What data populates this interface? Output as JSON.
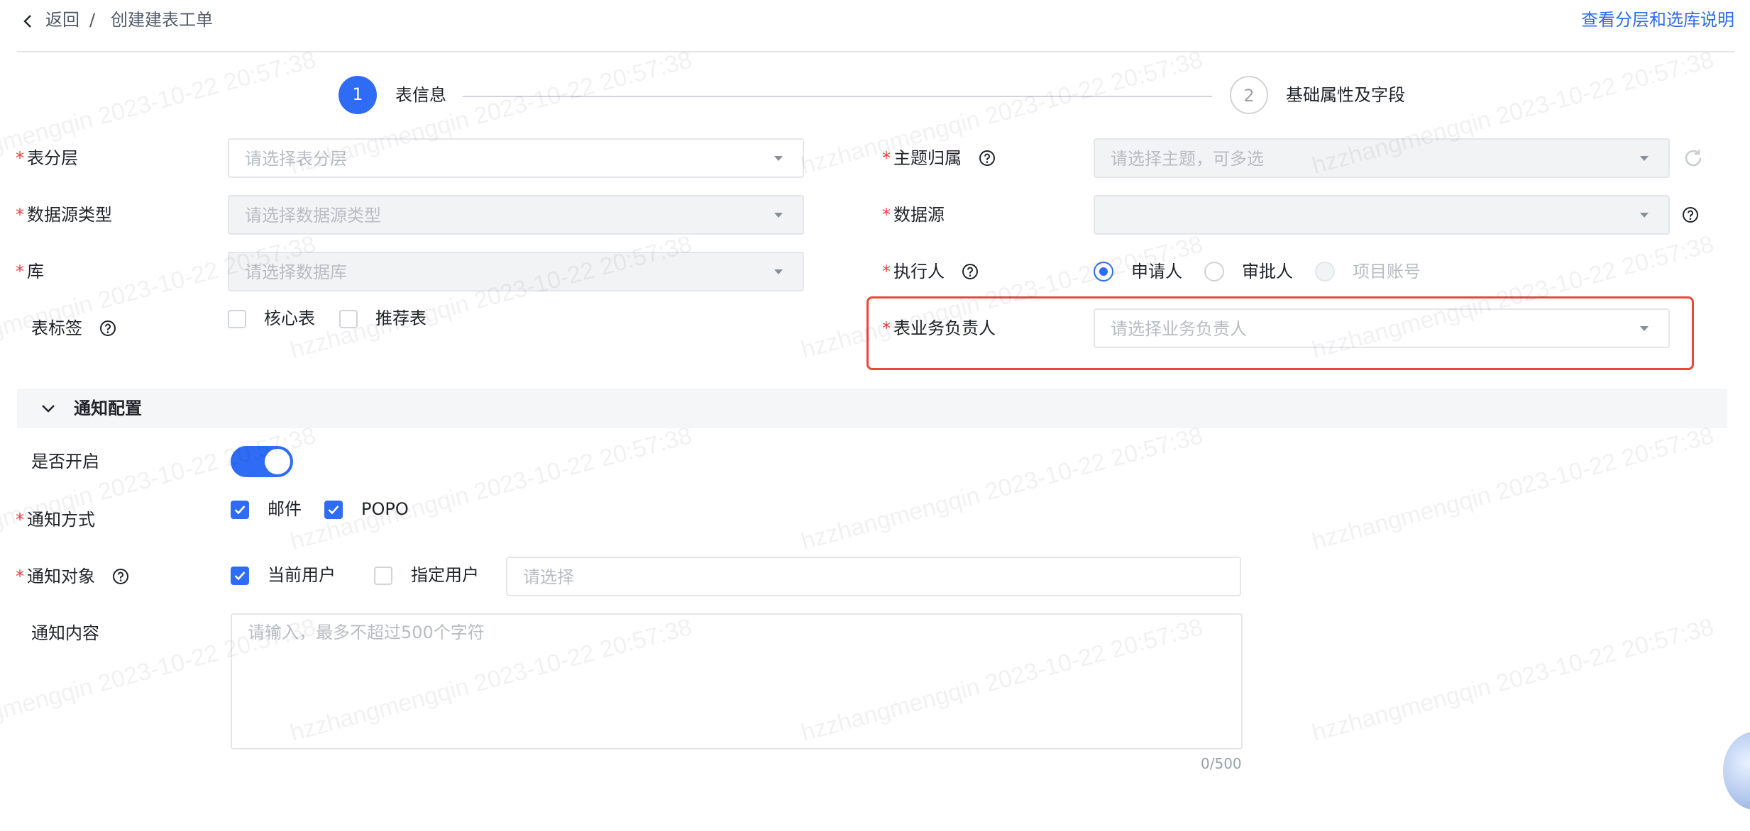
{
  "header": {
    "back_label": "返回",
    "separator": "/",
    "page_title": "创建建表工单",
    "doc_link": "查看分层和选库说明"
  },
  "steps": [
    {
      "number": "1",
      "label": "表信息"
    },
    {
      "number": "2",
      "label": "基础属性及字段"
    }
  ],
  "form": {
    "table_layer": {
      "label": "表分层",
      "placeholder": "请选择表分层"
    },
    "datasource_type": {
      "label": "数据源类型",
      "placeholder": "请选择数据源类型"
    },
    "database": {
      "label": "库",
      "placeholder": "请选择数据库"
    },
    "table_tags": {
      "label": "表标签",
      "options": [
        "核心表",
        "推荐表"
      ]
    },
    "topic": {
      "label": "主题归属",
      "placeholder": "请选择主题，可多选"
    },
    "datasource": {
      "label": "数据源",
      "placeholder": ""
    },
    "executor": {
      "label": "执行人",
      "options": [
        "申请人",
        "审批人",
        "项目账号"
      ]
    },
    "business_owner": {
      "label": "表业务负责人",
      "placeholder": "请选择业务负责人"
    }
  },
  "notification": {
    "section_title": "通知配置",
    "enable_label": "是否开启",
    "method_label": "通知方式",
    "methods": [
      "邮件",
      "POPO"
    ],
    "target_label": "通知对象",
    "targets": [
      "当前用户",
      "指定用户"
    ],
    "target_placeholder": "请选择",
    "content_label": "通知内容",
    "content_placeholder": "请输入，最多不超过500个字符",
    "counter": "0/500"
  },
  "watermark": "hzzhangmengqin 2023-10-22 20:57:38",
  "colors": {
    "primary": "#2f6cf5",
    "required": "#f53f3f",
    "highlight": "#e8483a"
  }
}
